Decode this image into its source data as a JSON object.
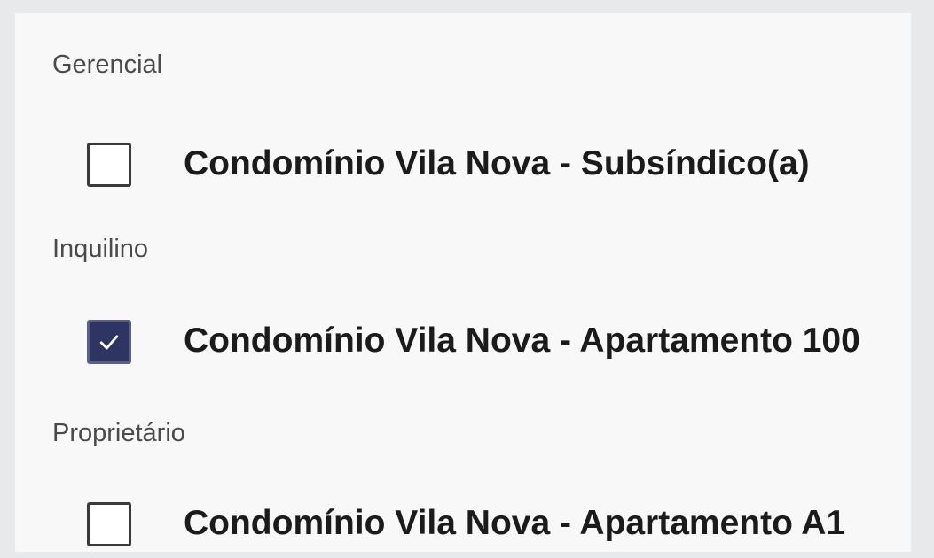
{
  "sections": [
    {
      "title": "Gerencial",
      "option": {
        "label": "Condomínio Vila Nova - Subsíndico(a)",
        "checked": false
      }
    },
    {
      "title": "Inquilino",
      "option": {
        "label": "Condomínio Vila Nova - Apartamento 100",
        "checked": true
      }
    },
    {
      "title": "Proprietário",
      "option": {
        "label": "Condomínio Vila Nova - Apartamento A1",
        "checked": false
      }
    }
  ],
  "colors": {
    "checked_fill": "#2e3563",
    "checkmark": "#ffffff",
    "label_text": "#1b1b1b",
    "section_text": "#4a4a4a"
  },
  "icons": {
    "checked": "check-icon"
  }
}
